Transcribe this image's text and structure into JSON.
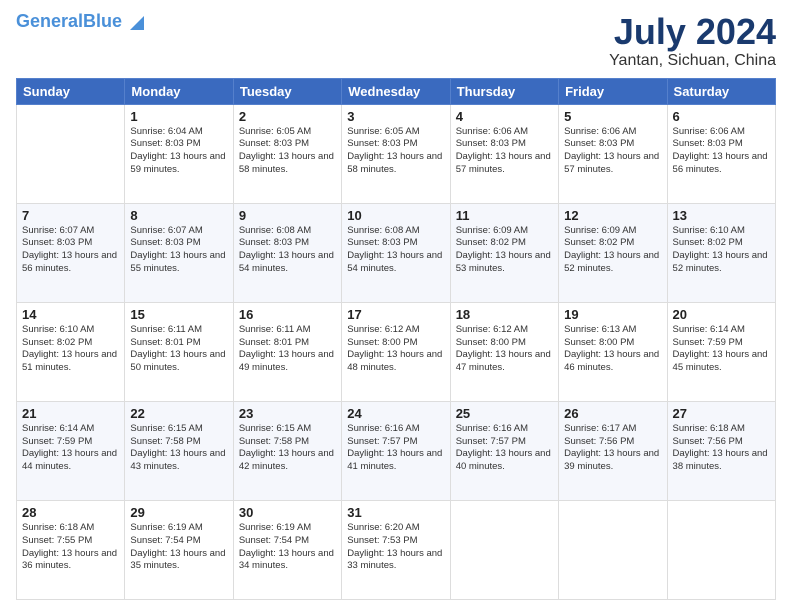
{
  "header": {
    "logo_line1": "General",
    "logo_line2": "Blue",
    "title": "July 2024",
    "subtitle": "Yantan, Sichuan, China"
  },
  "days_of_week": [
    "Sunday",
    "Monday",
    "Tuesday",
    "Wednesday",
    "Thursday",
    "Friday",
    "Saturday"
  ],
  "weeks": [
    [
      {
        "day": "",
        "sunrise": "",
        "sunset": "",
        "daylight": ""
      },
      {
        "day": "1",
        "sunrise": "Sunrise: 6:04 AM",
        "sunset": "Sunset: 8:03 PM",
        "daylight": "Daylight: 13 hours and 59 minutes."
      },
      {
        "day": "2",
        "sunrise": "Sunrise: 6:05 AM",
        "sunset": "Sunset: 8:03 PM",
        "daylight": "Daylight: 13 hours and 58 minutes."
      },
      {
        "day": "3",
        "sunrise": "Sunrise: 6:05 AM",
        "sunset": "Sunset: 8:03 PM",
        "daylight": "Daylight: 13 hours and 58 minutes."
      },
      {
        "day": "4",
        "sunrise": "Sunrise: 6:06 AM",
        "sunset": "Sunset: 8:03 PM",
        "daylight": "Daylight: 13 hours and 57 minutes."
      },
      {
        "day": "5",
        "sunrise": "Sunrise: 6:06 AM",
        "sunset": "Sunset: 8:03 PM",
        "daylight": "Daylight: 13 hours and 57 minutes."
      },
      {
        "day": "6",
        "sunrise": "Sunrise: 6:06 AM",
        "sunset": "Sunset: 8:03 PM",
        "daylight": "Daylight: 13 hours and 56 minutes."
      }
    ],
    [
      {
        "day": "7",
        "sunrise": "Sunrise: 6:07 AM",
        "sunset": "Sunset: 8:03 PM",
        "daylight": "Daylight: 13 hours and 56 minutes."
      },
      {
        "day": "8",
        "sunrise": "Sunrise: 6:07 AM",
        "sunset": "Sunset: 8:03 PM",
        "daylight": "Daylight: 13 hours and 55 minutes."
      },
      {
        "day": "9",
        "sunrise": "Sunrise: 6:08 AM",
        "sunset": "Sunset: 8:03 PM",
        "daylight": "Daylight: 13 hours and 54 minutes."
      },
      {
        "day": "10",
        "sunrise": "Sunrise: 6:08 AM",
        "sunset": "Sunset: 8:03 PM",
        "daylight": "Daylight: 13 hours and 54 minutes."
      },
      {
        "day": "11",
        "sunrise": "Sunrise: 6:09 AM",
        "sunset": "Sunset: 8:02 PM",
        "daylight": "Daylight: 13 hours and 53 minutes."
      },
      {
        "day": "12",
        "sunrise": "Sunrise: 6:09 AM",
        "sunset": "Sunset: 8:02 PM",
        "daylight": "Daylight: 13 hours and 52 minutes."
      },
      {
        "day": "13",
        "sunrise": "Sunrise: 6:10 AM",
        "sunset": "Sunset: 8:02 PM",
        "daylight": "Daylight: 13 hours and 52 minutes."
      }
    ],
    [
      {
        "day": "14",
        "sunrise": "Sunrise: 6:10 AM",
        "sunset": "Sunset: 8:02 PM",
        "daylight": "Daylight: 13 hours and 51 minutes."
      },
      {
        "day": "15",
        "sunrise": "Sunrise: 6:11 AM",
        "sunset": "Sunset: 8:01 PM",
        "daylight": "Daylight: 13 hours and 50 minutes."
      },
      {
        "day": "16",
        "sunrise": "Sunrise: 6:11 AM",
        "sunset": "Sunset: 8:01 PM",
        "daylight": "Daylight: 13 hours and 49 minutes."
      },
      {
        "day": "17",
        "sunrise": "Sunrise: 6:12 AM",
        "sunset": "Sunset: 8:00 PM",
        "daylight": "Daylight: 13 hours and 48 minutes."
      },
      {
        "day": "18",
        "sunrise": "Sunrise: 6:12 AM",
        "sunset": "Sunset: 8:00 PM",
        "daylight": "Daylight: 13 hours and 47 minutes."
      },
      {
        "day": "19",
        "sunrise": "Sunrise: 6:13 AM",
        "sunset": "Sunset: 8:00 PM",
        "daylight": "Daylight: 13 hours and 46 minutes."
      },
      {
        "day": "20",
        "sunrise": "Sunrise: 6:14 AM",
        "sunset": "Sunset: 7:59 PM",
        "daylight": "Daylight: 13 hours and 45 minutes."
      }
    ],
    [
      {
        "day": "21",
        "sunrise": "Sunrise: 6:14 AM",
        "sunset": "Sunset: 7:59 PM",
        "daylight": "Daylight: 13 hours and 44 minutes."
      },
      {
        "day": "22",
        "sunrise": "Sunrise: 6:15 AM",
        "sunset": "Sunset: 7:58 PM",
        "daylight": "Daylight: 13 hours and 43 minutes."
      },
      {
        "day": "23",
        "sunrise": "Sunrise: 6:15 AM",
        "sunset": "Sunset: 7:58 PM",
        "daylight": "Daylight: 13 hours and 42 minutes."
      },
      {
        "day": "24",
        "sunrise": "Sunrise: 6:16 AM",
        "sunset": "Sunset: 7:57 PM",
        "daylight": "Daylight: 13 hours and 41 minutes."
      },
      {
        "day": "25",
        "sunrise": "Sunrise: 6:16 AM",
        "sunset": "Sunset: 7:57 PM",
        "daylight": "Daylight: 13 hours and 40 minutes."
      },
      {
        "day": "26",
        "sunrise": "Sunrise: 6:17 AM",
        "sunset": "Sunset: 7:56 PM",
        "daylight": "Daylight: 13 hours and 39 minutes."
      },
      {
        "day": "27",
        "sunrise": "Sunrise: 6:18 AM",
        "sunset": "Sunset: 7:56 PM",
        "daylight": "Daylight: 13 hours and 38 minutes."
      }
    ],
    [
      {
        "day": "28",
        "sunrise": "Sunrise: 6:18 AM",
        "sunset": "Sunset: 7:55 PM",
        "daylight": "Daylight: 13 hours and 36 minutes."
      },
      {
        "day": "29",
        "sunrise": "Sunrise: 6:19 AM",
        "sunset": "Sunset: 7:54 PM",
        "daylight": "Daylight: 13 hours and 35 minutes."
      },
      {
        "day": "30",
        "sunrise": "Sunrise: 6:19 AM",
        "sunset": "Sunset: 7:54 PM",
        "daylight": "Daylight: 13 hours and 34 minutes."
      },
      {
        "day": "31",
        "sunrise": "Sunrise: 6:20 AM",
        "sunset": "Sunset: 7:53 PM",
        "daylight": "Daylight: 13 hours and 33 minutes."
      },
      {
        "day": "",
        "sunrise": "",
        "sunset": "",
        "daylight": ""
      },
      {
        "day": "",
        "sunrise": "",
        "sunset": "",
        "daylight": ""
      },
      {
        "day": "",
        "sunrise": "",
        "sunset": "",
        "daylight": ""
      }
    ]
  ]
}
